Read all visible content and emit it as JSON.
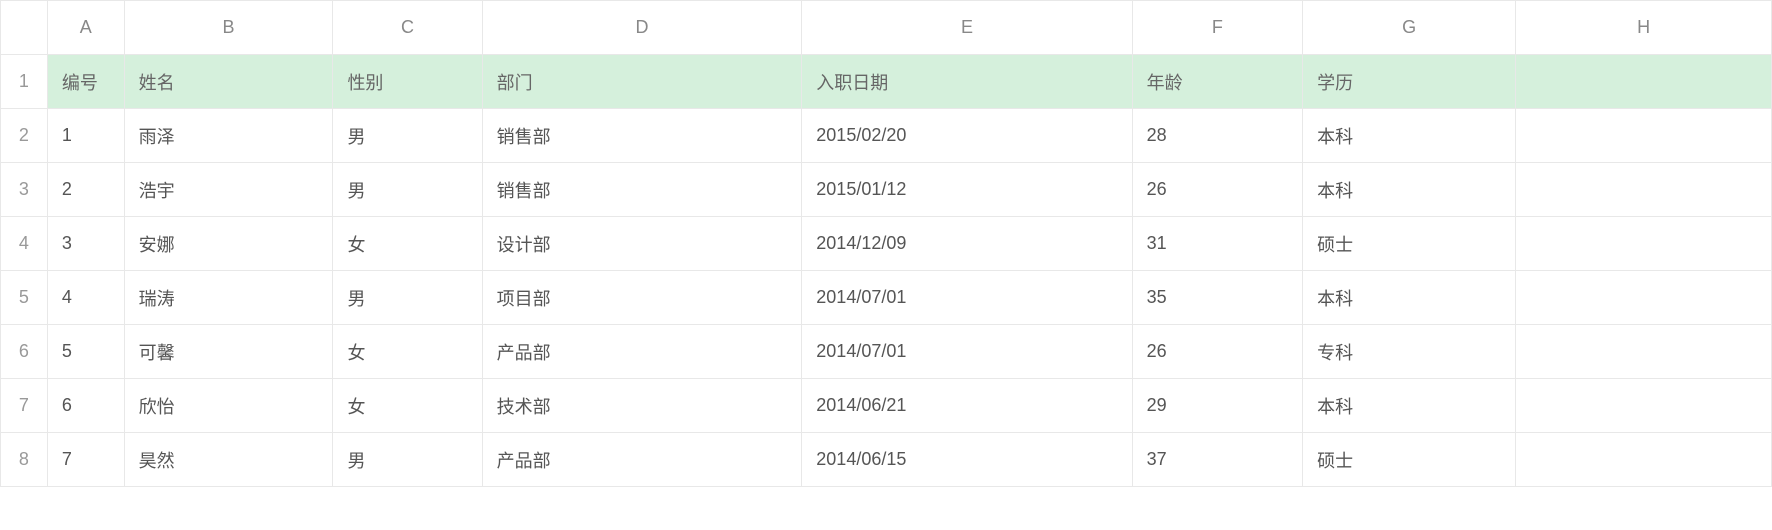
{
  "columns": [
    "A",
    "B",
    "C",
    "D",
    "E",
    "F",
    "G",
    "H"
  ],
  "row_numbers": [
    "1",
    "2",
    "3",
    "4",
    "5",
    "6",
    "7",
    "8"
  ],
  "header_row": {
    "A": "编号",
    "B": "姓名",
    "C": "性别",
    "D": "部门",
    "E": "入职日期",
    "F": "年龄",
    "G": "学历",
    "H": ""
  },
  "rows": [
    {
      "A": "1",
      "B": "雨泽",
      "C": "男",
      "D": "销售部",
      "E": "2015/02/20",
      "F": "28",
      "G": "本科",
      "H": ""
    },
    {
      "A": "2",
      "B": "浩宇",
      "C": "男",
      "D": "销售部",
      "E": "2015/01/12",
      "F": "26",
      "G": "本科",
      "H": ""
    },
    {
      "A": "3",
      "B": "安娜",
      "C": "女",
      "D": "设计部",
      "E": "2014/12/09",
      "F": "31",
      "G": "硕士",
      "H": ""
    },
    {
      "A": "4",
      "B": "瑞涛",
      "C": "男",
      "D": "项目部",
      "E": "2014/07/01",
      "F": "35",
      "G": "本科",
      "H": ""
    },
    {
      "A": "5",
      "B": "可馨",
      "C": "女",
      "D": "产品部",
      "E": "2014/07/01",
      "F": "26",
      "G": "专科",
      "H": ""
    },
    {
      "A": "6",
      "B": "欣怡",
      "C": "女",
      "D": "技术部",
      "E": "2014/06/21",
      "F": "29",
      "G": "本科",
      "H": ""
    },
    {
      "A": "7",
      "B": "昊然",
      "C": "男",
      "D": "产品部",
      "E": "2014/06/15",
      "F": "37",
      "G": "硕士",
      "H": ""
    }
  ],
  "colors": {
    "header_band_bg": "#d5f0dc",
    "grid_line": "#e8e8e8"
  }
}
